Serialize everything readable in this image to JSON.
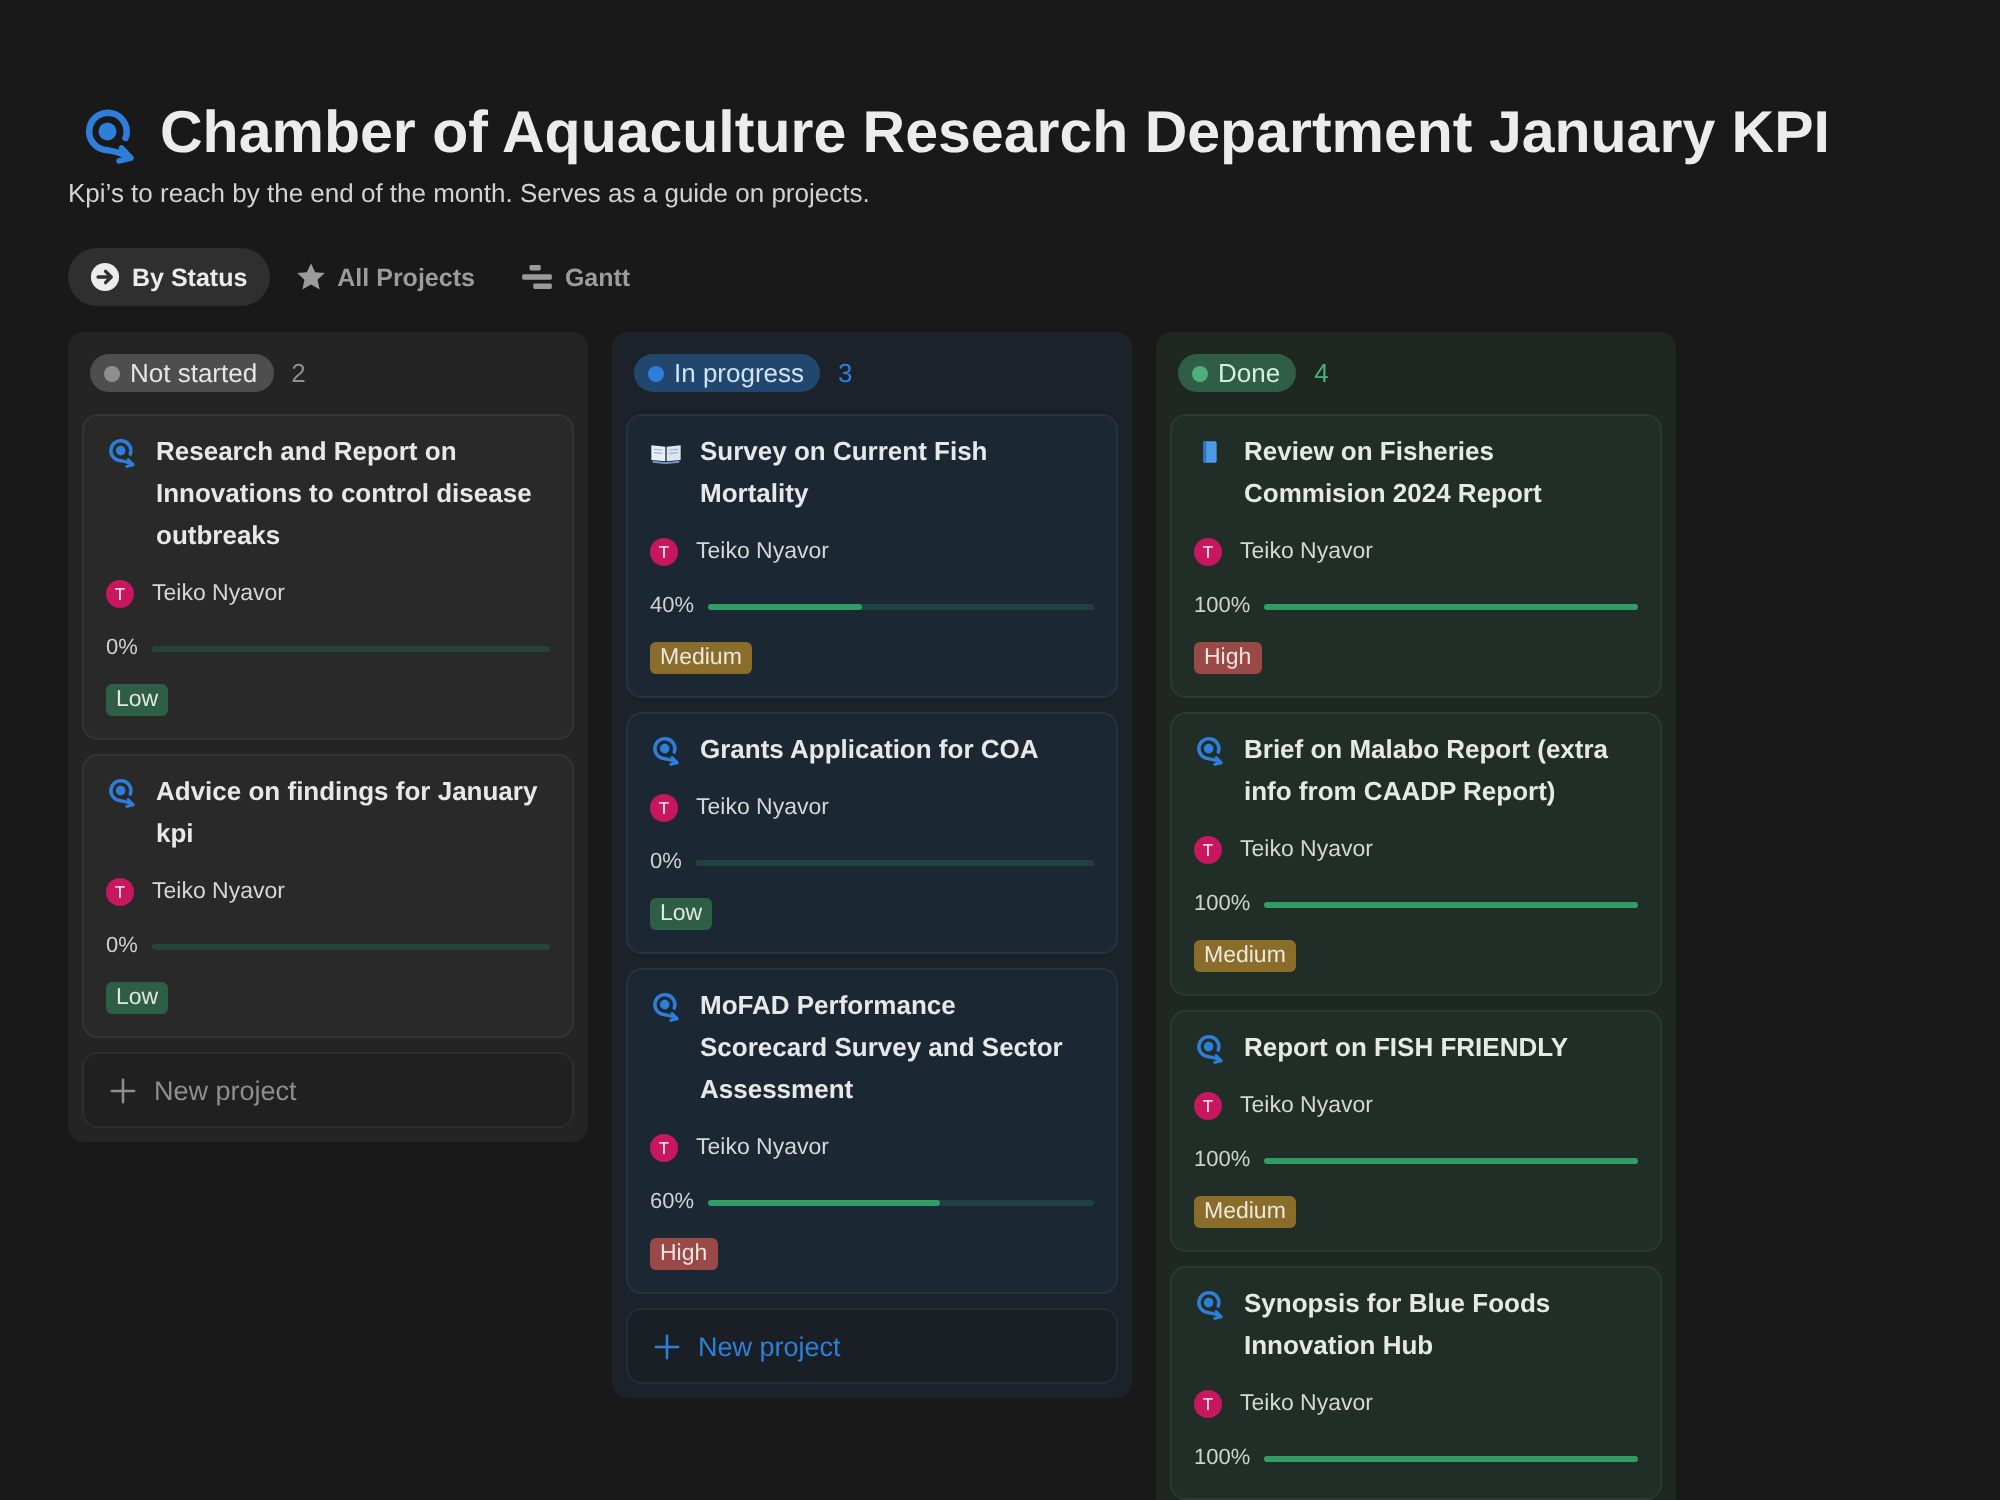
{
  "page": {
    "title": "Chamber of Aquaculture Research Department January KPI",
    "description": "Kpi’s to reach by the end of the month. Serves as a guide on projects."
  },
  "views": [
    {
      "label": "By Status",
      "kind": "status",
      "selected": true
    },
    {
      "label": "All Projects",
      "kind": "star",
      "selected": false
    },
    {
      "label": "Gantt",
      "kind": "gantt",
      "selected": false
    }
  ],
  "columns": [
    {
      "status": "Not started",
      "color": "#8e8e8e",
      "count": "2",
      "cards": [
        {
          "kind": "target",
          "title": "Research and Report on Innovations to control disease outbreaks",
          "assignee": {
            "initial": "T",
            "name": "Teiko Nyavor"
          },
          "progress": "0%",
          "level": 0,
          "priority": {
            "label": "Low",
            "color": "#2f5e46"
          }
        },
        {
          "kind": "target",
          "title": "Advice on findings for January kpi",
          "assignee": {
            "initial": "T",
            "name": "Teiko Nyavor"
          },
          "progress": "0%",
          "level": 0,
          "priority": {
            "label": "Low",
            "color": "#2f5e46"
          }
        }
      ],
      "new_label": "New project"
    },
    {
      "status": "In progress",
      "color": "#2e7fd9",
      "count": "3",
      "cards": [
        {
          "kind": "book",
          "title": "Survey on Current Fish Mortality",
          "assignee": {
            "initial": "T",
            "name": "Teiko Nyavor"
          },
          "progress": "40%",
          "level": 0.4,
          "priority": {
            "label": "Medium",
            "color": "#8a6c2b"
          }
        },
        {
          "kind": "target",
          "title": "Grants Application for COA",
          "assignee": {
            "initial": "T",
            "name": "Teiko Nyavor"
          },
          "progress": "0%",
          "level": 0,
          "priority": {
            "label": "Low",
            "color": "#2f5e46"
          }
        },
        {
          "kind": "target",
          "title": "MoFAD Performance Scorecard Survey and Sector Assessment",
          "assignee": {
            "initial": "T",
            "name": "Teiko Nyavor"
          },
          "progress": "60%",
          "level": 0.6,
          "priority": {
            "label": "High",
            "color": "#9a4a46"
          }
        }
      ],
      "new_label": "New project"
    },
    {
      "status": "Done",
      "color": "#4caf7a",
      "count": "4",
      "cards": [
        {
          "kind": "notebook",
          "title": "Review on Fisheries Commision 2024 Report",
          "assignee": {
            "initial": "T",
            "name": "Teiko Nyavor"
          },
          "progress": "100%",
          "level": 1,
          "priority": {
            "label": "High",
            "color": "#9a4a46"
          }
        },
        {
          "kind": "target",
          "title": "Brief on Malabo Report (extra info from CAADP Report)",
          "assignee": {
            "initial": "T",
            "name": "Teiko Nyavor"
          },
          "progress": "100%",
          "level": 1,
          "priority": {
            "label": "Medium",
            "color": "#8a6c2b"
          }
        },
        {
          "kind": "target",
          "title": "Report on FISH FRIENDLY",
          "assignee": {
            "initial": "T",
            "name": "Teiko Nyavor"
          },
          "progress": "100%",
          "level": 1,
          "priority": {
            "label": "Medium",
            "color": "#8a6c2b"
          }
        },
        {
          "kind": "target",
          "title": "Synopsis for Blue Foods Innovation Hub",
          "assignee": {
            "initial": "T",
            "name": "Teiko Nyavor"
          },
          "progress": "100%",
          "level": 1
        }
      ]
    }
  ]
}
